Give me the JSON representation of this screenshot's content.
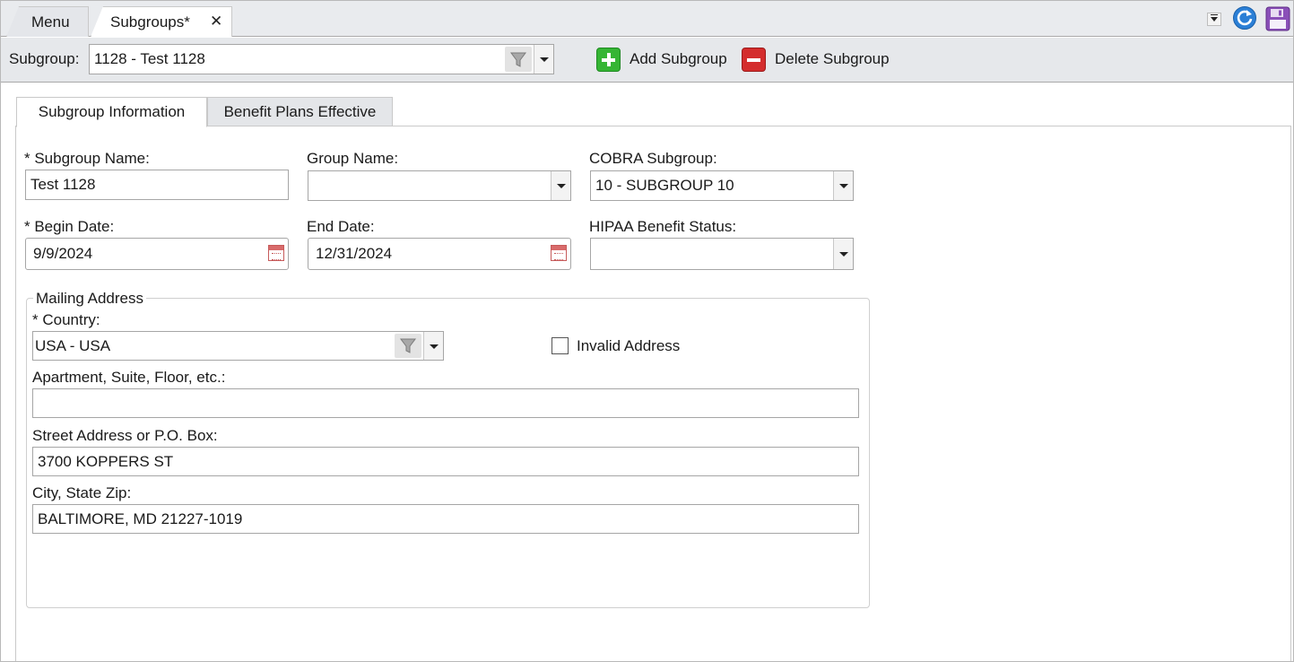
{
  "tabs": [
    {
      "label": "Menu"
    },
    {
      "label": "Subgroups*"
    }
  ],
  "icons": {
    "tab_close": "close-icon",
    "window_menu": "dropdown-icon",
    "refresh": "refresh-icon",
    "save": "save-icon",
    "filter": "filter-icon",
    "calendar": "calendar-icon",
    "add": "add-icon",
    "delete": "delete-icon"
  },
  "toolbar": {
    "subgroup_label": "Subgroup:",
    "subgroup_value": "1128 - Test 1128",
    "add_label": "Add Subgroup",
    "delete_label": "Delete Subgroup"
  },
  "inner_tabs": [
    {
      "label": "Subgroup Information"
    },
    {
      "label": "Benefit Plans Effective"
    }
  ],
  "form": {
    "subgroup_name_label": "* Subgroup Name:",
    "subgroup_name_value": "Test 1128",
    "group_name_label": "Group Name:",
    "group_name_value": "",
    "cobra_label": "COBRA Subgroup:",
    "cobra_value": "10 - SUBGROUP 10",
    "begin_date_label": "* Begin Date:",
    "begin_date_value": "9/9/2024",
    "end_date_label": "End Date:",
    "end_date_value": "12/31/2024",
    "hipaa_label": "HIPAA Benefit Status:",
    "hipaa_value": ""
  },
  "mailing": {
    "legend": "Mailing Address",
    "country_label": "* Country:",
    "country_value": "USA - USA",
    "invalid_label": "Invalid Address",
    "invalid_checked": false,
    "apartment_label": "Apartment, Suite, Floor, etc.:",
    "apartment_value": "",
    "street_label": "Street Address or P.O. Box:",
    "street_value": "3700 KOPPERS ST",
    "city_label": "City, State Zip:",
    "city_value": "BALTIMORE, MD 21227-1019"
  },
  "colors": {
    "add_green": "#35b534",
    "delete_red": "#d42d2d",
    "refresh_blue": "#2b7fd6",
    "save_purple": "#8a4fb8"
  }
}
